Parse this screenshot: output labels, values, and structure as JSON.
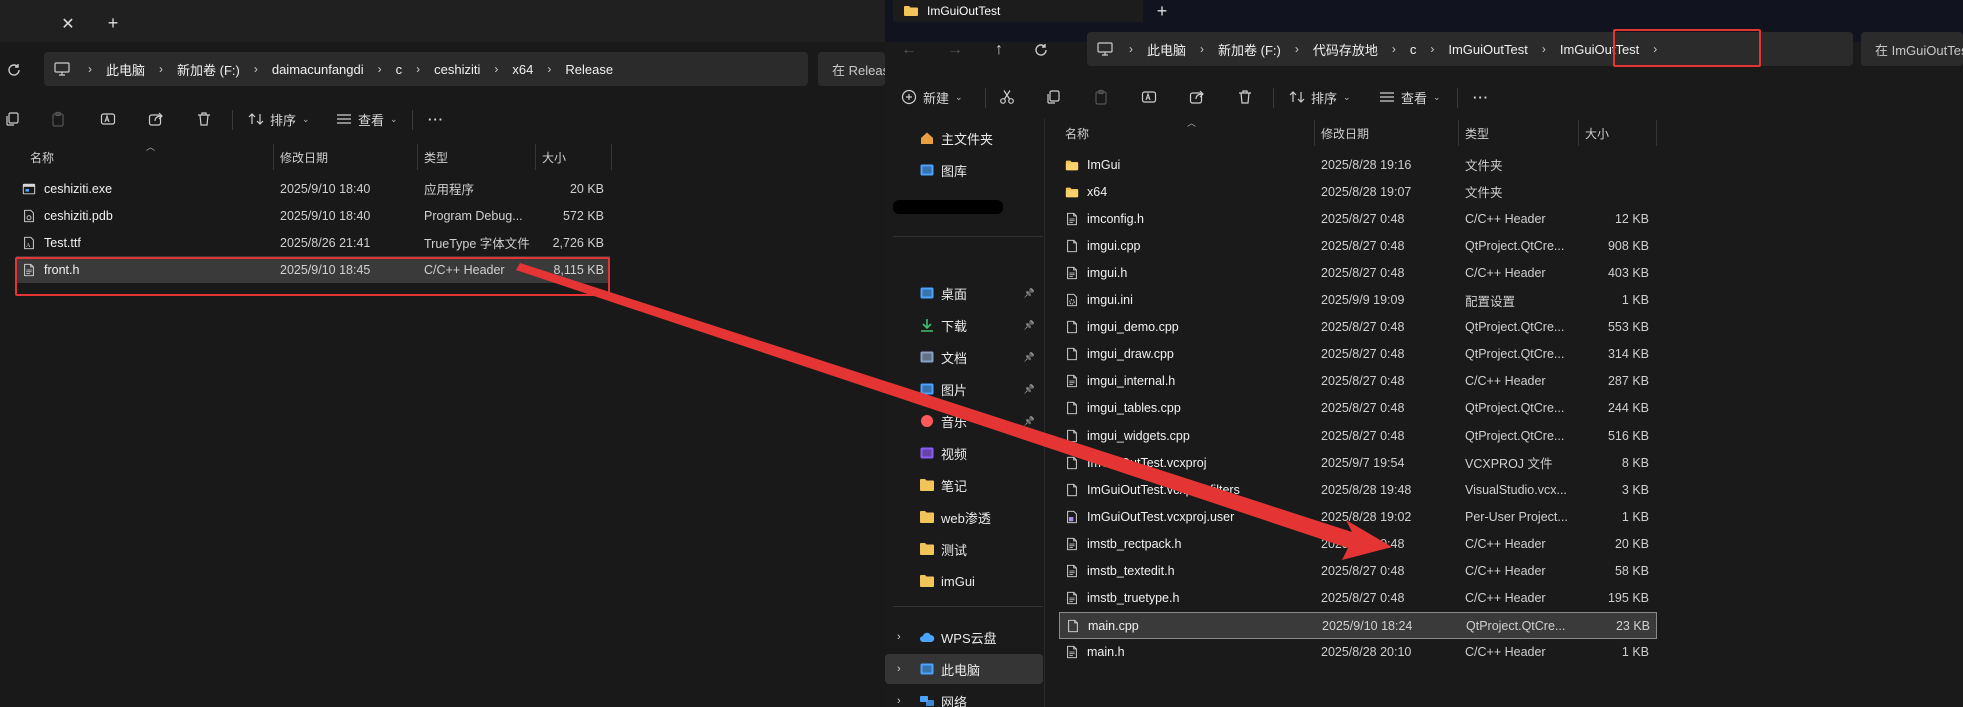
{
  "left_window": {
    "breadcrumb": [
      "此电脑",
      "新加卷 (F:)",
      "daimacunfangdi",
      "c",
      "ceshiziti",
      "x64",
      "Release"
    ],
    "search_placeholder": "在 Release 中搜索",
    "toolbar": {
      "sort_label": "排序",
      "view_label": "查看",
      "more_label": "···"
    },
    "headers": {
      "name": "名称",
      "date": "修改日期",
      "type": "类型",
      "size": "大小"
    },
    "files": [
      {
        "name": "ceshiziti.exe",
        "date": "2025/9/10 18:40",
        "type": "应用程序",
        "size": "20 KB",
        "icon": "exe-icon"
      },
      {
        "name": "ceshiziti.pdb",
        "date": "2025/9/10 18:40",
        "type": "Program Debug...",
        "size": "572 KB",
        "icon": "pdb-file-icon"
      },
      {
        "name": "Test.ttf",
        "date": "2025/8/26 21:41",
        "type": "TrueType 字体文件",
        "size": "2,726 KB",
        "icon": "font-file-icon"
      },
      {
        "name": "front.h",
        "date": "2025/9/10 18:45",
        "type": "C/C++ Header",
        "size": "8,115 KB",
        "icon": "header-file-icon"
      }
    ]
  },
  "right_window": {
    "tab_title": "ImGuiOutTest",
    "new_tab_label": "+",
    "breadcrumb": [
      "此电脑",
      "新加卷 (F:)",
      "代码存放地",
      "c",
      "ImGuiOutTest",
      "ImGuiOutTest"
    ],
    "search_placeholder": "在 ImGuiOutTest 中搜索",
    "toolbar": {
      "new_label": "新建",
      "sort_label": "排序",
      "view_label": "查看",
      "more_label": "···"
    },
    "headers": {
      "name": "名称",
      "date": "修改日期",
      "type": "类型",
      "size": "大小"
    },
    "nav_items": [
      {
        "label": "主文件夹",
        "icon": "home-icon"
      },
      {
        "label": "图库",
        "icon": "gallery-icon"
      },
      {
        "label": "桌面",
        "icon": "desktop-icon"
      },
      {
        "label": "下载",
        "icon": "download-icon"
      },
      {
        "label": "文档",
        "icon": "documents-icon"
      },
      {
        "label": "图片",
        "icon": "pictures-icon"
      },
      {
        "label": "音乐",
        "icon": "music-icon"
      },
      {
        "label": "视频",
        "icon": "videos-icon"
      },
      {
        "label": "笔记",
        "icon": "folder-icon"
      },
      {
        "label": "web渗透",
        "icon": "folder-icon"
      },
      {
        "label": "测试",
        "icon": "folder-icon"
      },
      {
        "label": "imGui",
        "icon": "folder-icon"
      },
      {
        "label": "WPS云盘",
        "icon": "cloud-icon"
      },
      {
        "label": "此电脑",
        "icon": "this-pc-icon"
      },
      {
        "label": "网络",
        "icon": "network-icon"
      }
    ],
    "files": [
      {
        "name": "ImGui",
        "date": "2025/8/28 19:16",
        "type": "文件夹",
        "size": "",
        "icon": "folder-icon"
      },
      {
        "name": "x64",
        "date": "2025/8/28 19:07",
        "type": "文件夹",
        "size": "",
        "icon": "folder-icon"
      },
      {
        "name": "imconfig.h",
        "date": "2025/8/27 0:48",
        "type": "C/C++ Header",
        "size": "12 KB",
        "icon": "header-file-icon"
      },
      {
        "name": "imgui.cpp",
        "date": "2025/8/27 0:48",
        "type": "QtProject.QtCre...",
        "size": "908 KB",
        "icon": "cpp-file-icon"
      },
      {
        "name": "imgui.h",
        "date": "2025/8/27 0:48",
        "type": "C/C++ Header",
        "size": "403 KB",
        "icon": "header-file-icon"
      },
      {
        "name": "imgui.ini",
        "date": "2025/9/9 19:09",
        "type": "配置设置",
        "size": "1 KB",
        "icon": "ini-file-icon"
      },
      {
        "name": "imgui_demo.cpp",
        "date": "2025/8/27 0:48",
        "type": "QtProject.QtCre...",
        "size": "553 KB",
        "icon": "cpp-file-icon"
      },
      {
        "name": "imgui_draw.cpp",
        "date": "2025/8/27 0:48",
        "type": "QtProject.QtCre...",
        "size": "314 KB",
        "icon": "cpp-file-icon"
      },
      {
        "name": "imgui_internal.h",
        "date": "2025/8/27 0:48",
        "type": "C/C++ Header",
        "size": "287 KB",
        "icon": "header-file-icon"
      },
      {
        "name": "imgui_tables.cpp",
        "date": "2025/8/27 0:48",
        "type": "QtProject.QtCre...",
        "size": "244 KB",
        "icon": "cpp-file-icon"
      },
      {
        "name": "imgui_widgets.cpp",
        "date": "2025/8/27 0:48",
        "type": "QtProject.QtCre...",
        "size": "516 KB",
        "icon": "cpp-file-icon"
      },
      {
        "name": "ImGuiOutTest.vcxproj",
        "date": "2025/9/7 19:54",
        "type": "VCXPROJ 文件",
        "size": "8 KB",
        "icon": "vcxproj-file-icon"
      },
      {
        "name": "ImGuiOutTest.vcxproj.filters",
        "date": "2025/8/28 19:48",
        "type": "VisualStudio.vcx...",
        "size": "3 KB",
        "icon": "filters-file-icon"
      },
      {
        "name": "ImGuiOutTest.vcxproj.user",
        "date": "2025/8/28 19:02",
        "type": "Per-User Project...",
        "size": "1 KB",
        "icon": "user-file-icon"
      },
      {
        "name": "imstb_rectpack.h",
        "date": "2025/8/27 0:48",
        "type": "C/C++ Header",
        "size": "20 KB",
        "icon": "header-file-icon"
      },
      {
        "name": "imstb_textedit.h",
        "date": "2025/8/27 0:48",
        "type": "C/C++ Header",
        "size": "58 KB",
        "icon": "header-file-icon"
      },
      {
        "name": "imstb_truetype.h",
        "date": "2025/8/27 0:48",
        "type": "C/C++ Header",
        "size": "195 KB",
        "icon": "header-file-icon"
      },
      {
        "name": "main.cpp",
        "date": "2025/9/10 18:24",
        "type": "QtProject.QtCre...",
        "size": "23 KB",
        "icon": "cpp-file-icon"
      },
      {
        "name": "main.h",
        "date": "2025/8/28 20:10",
        "type": "C/C++ Header",
        "size": "1 KB",
        "icon": "header-file-icon"
      }
    ]
  },
  "colors": {
    "annotation_red": "#e53434",
    "folder_yellow": "#f2c45a",
    "accent_blue": "#4aa3ff"
  }
}
